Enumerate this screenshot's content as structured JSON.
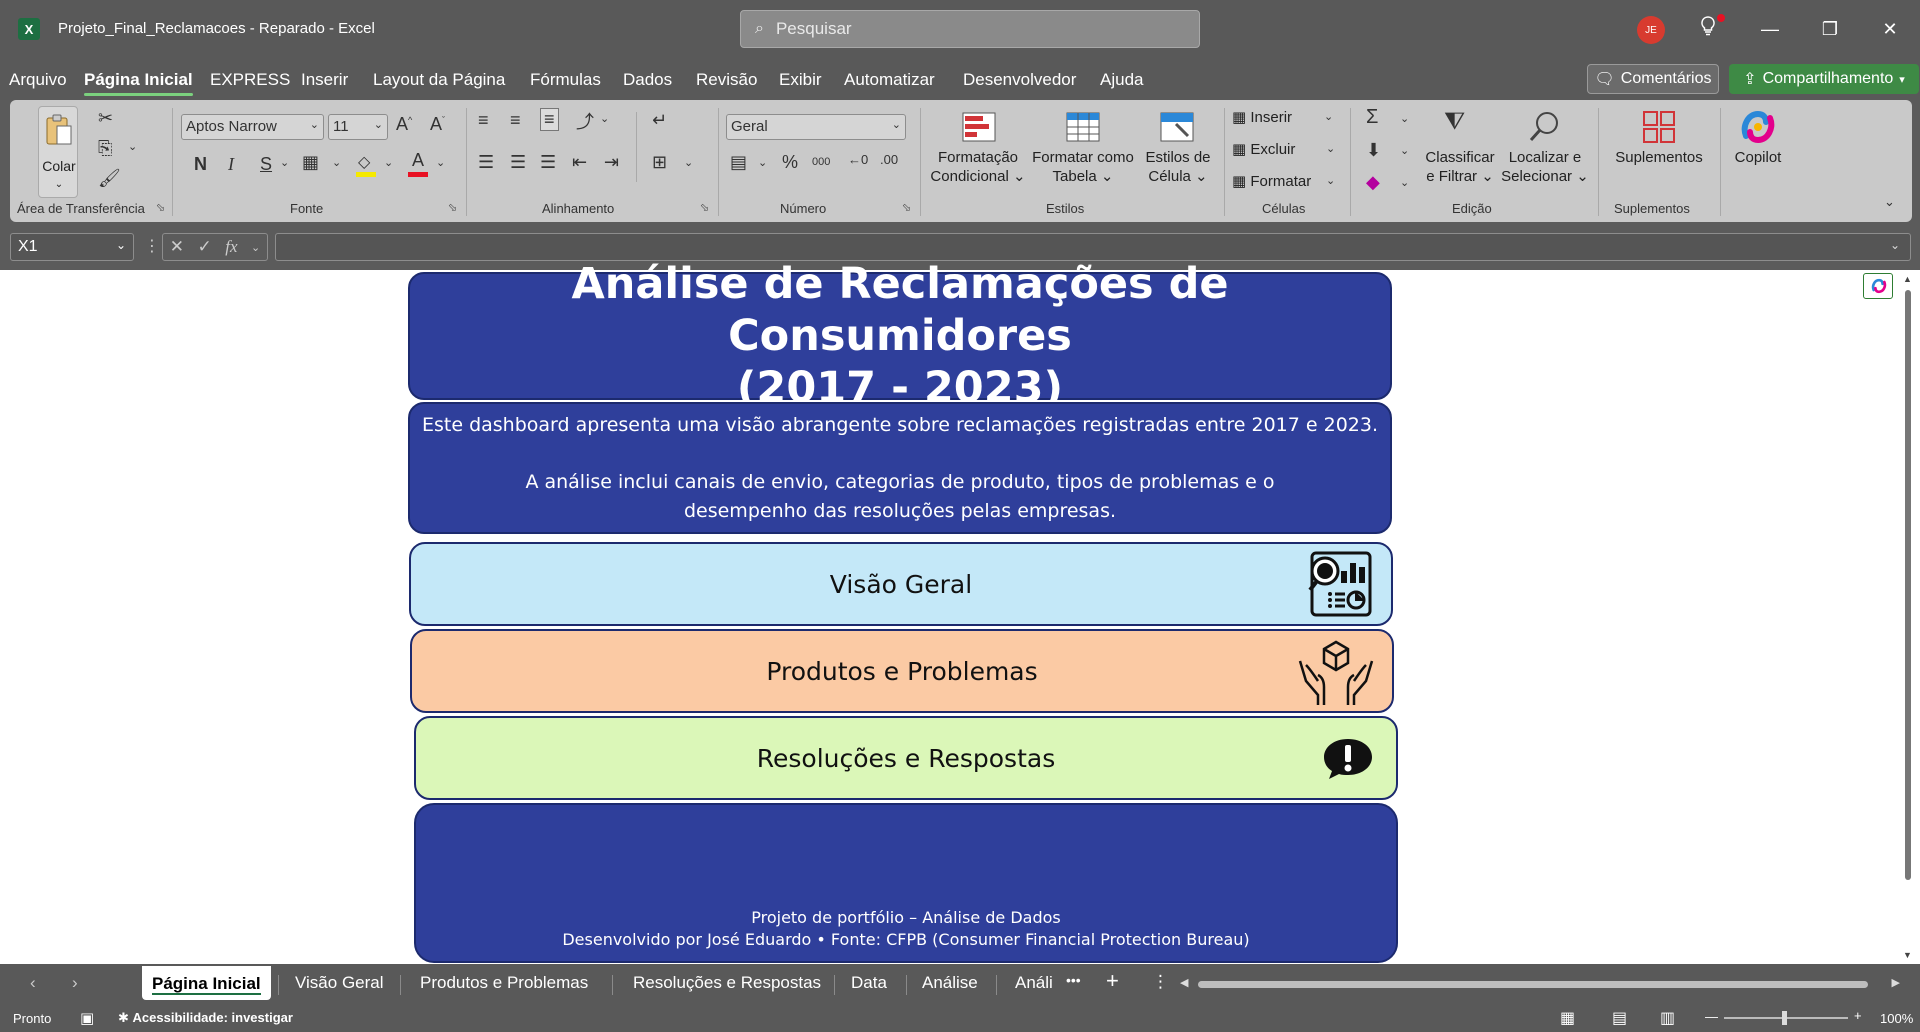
{
  "titlebar": {
    "app_icon": "excel-logo",
    "doc_title": "Projeto_Final_Reclamacoes  -  Reparado  -  Excel",
    "search_placeholder": "Pesquisar",
    "avatar_initials": "JE"
  },
  "menu": {
    "tabs": [
      "Arquivo",
      "Página Inicial",
      "EXPRESS",
      "Inserir",
      "Layout da Página",
      "Fórmulas",
      "Dados",
      "Revisão",
      "Exibir",
      "Automatizar",
      "Desenvolvedor",
      "Ajuda"
    ],
    "active_tab": "Página Inicial",
    "comments_label": "Comentários",
    "share_label": "Compartilhamento"
  },
  "ribbon": {
    "clipboard": {
      "paste_label": "Colar",
      "group_label": "Área de Transferência"
    },
    "font": {
      "font_name": "Aptos Narrow",
      "font_size": "11",
      "bold": "N",
      "italic": "I",
      "underline": "S",
      "group_label": "Fonte"
    },
    "alignment": {
      "group_label": "Alinhamento"
    },
    "number": {
      "format": "Geral",
      "group_label": "Número"
    },
    "styles": {
      "conditional": [
        "Formatação",
        "Condicional"
      ],
      "as_table": [
        "Formatar como",
        "Tabela"
      ],
      "cell_styles": [
        "Estilos de",
        "Célula"
      ],
      "group_label": "Estilos"
    },
    "cells": {
      "insert": "Inserir",
      "delete": "Excluir",
      "format": "Formatar",
      "group_label": "Células"
    },
    "editing": {
      "sort_filter": [
        "Classificar",
        "e Filtrar"
      ],
      "find_select": [
        "Localizar e",
        "Selecionar"
      ],
      "group_label": "Edição"
    },
    "addins": {
      "label": "Suplementos",
      "group_label": "Suplementos"
    },
    "copilot": {
      "label": "Copilot"
    }
  },
  "formula_bar": {
    "name_box": "X1",
    "fx": "fx",
    "formula": ""
  },
  "dashboard": {
    "title_line1": "Análise de Reclamações de Consumidores",
    "title_line2": "(2017 - 2023)",
    "desc_line1": "Este dashboard apresenta uma visão abrangente sobre reclamações registradas entre 2017 e 2023.",
    "desc_line2": "A análise inclui canais de envio, categorias de produto, tipos de problemas e o",
    "desc_line3": "desempenho das resoluções pelas empresas.",
    "nav": [
      {
        "label": "Visão Geral",
        "color": "#c4e8f8",
        "icon": "analytics-icon"
      },
      {
        "label": "Produtos e Problemas",
        "color": "#fbcaa4",
        "icon": "hands-box-icon"
      },
      {
        "label": "Resoluções e Respostas",
        "color": "#dbf7b8",
        "icon": "exclamation-bubble-icon"
      }
    ],
    "footer_line1": "Projeto de portfólio – Análise de Dados",
    "footer_line2": "Desenvolvido por José Eduardo • Fonte: CFPB (Consumer Financial Protection Bureau)",
    "card_color": "#2f3f9b"
  },
  "sheet_tabs": {
    "tabs": [
      "Página Inicial",
      "Visão Geral",
      "Produtos e Problemas",
      "Resoluções e Respostas",
      "Data",
      "Análise",
      "Análi"
    ],
    "active": "Página Inicial"
  },
  "status": {
    "ready": "Pronto",
    "accessibility": "Acessibilidade: investigar",
    "zoom": "100%"
  }
}
